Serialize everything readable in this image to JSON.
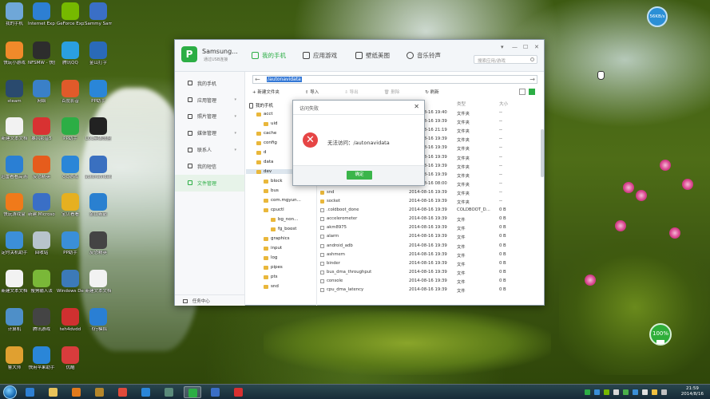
{
  "desktop": {
    "icons": [
      {
        "label": "我的手机",
        "color": "#6fa7d8"
      },
      {
        "label": "快玩小游戏",
        "color": "#f08a2a"
      },
      {
        "label": "steam",
        "color": "#2a4a6e"
      },
      {
        "label": "新建文本文档",
        "color": "#f2f2f2"
      },
      {
        "label": "迅雷看看高清影视",
        "color": "#2a7fd4"
      },
      {
        "label": "快玩游戏盒",
        "color": "#f07a1a"
      },
      {
        "label": "定时关机助手",
        "color": "#3c8fd8"
      },
      {
        "label": "新建文本文档",
        "color": "#f2f2f2"
      },
      {
        "label": "计算机",
        "color": "#4e8fc8"
      },
      {
        "label": "鲁大师",
        "color": "#e0a030"
      },
      {
        "label": "Internet Explorer",
        "color": "#2d7fd3"
      },
      {
        "label": "NFSMW - 快捷方式",
        "color": "#2d2d2d"
      },
      {
        "label": "网络",
        "color": "#3a80c8"
      },
      {
        "label": "暴风影音5",
        "color": "#d83232"
      },
      {
        "label": "反恐精英",
        "color": "#e65c1c"
      },
      {
        "label": "新建 Microsoft Word",
        "color": "#3a6fc6"
      },
      {
        "label": "回收站",
        "color": "#b8c4cc"
      },
      {
        "label": "搜狗输入法",
        "color": "#7ab838"
      },
      {
        "label": "腾讯游戏",
        "color": "#444444"
      },
      {
        "label": "快用苹果助手",
        "color": "#2a86d8"
      },
      {
        "label": "GeForce Experience",
        "color": "#76b900"
      },
      {
        "label": "腾讯QQ",
        "color": "#2a9fe0"
      },
      {
        "label": "百度影音",
        "color": "#e05a2a"
      },
      {
        "label": "PP助手",
        "color": "#2cae45"
      },
      {
        "label": "QQ游戏",
        "color": "#2a86d8"
      },
      {
        "label": "宝贝看看",
        "color": "#e6b020"
      },
      {
        "label": "PP助手",
        "color": "#3a8fd8"
      },
      {
        "label": "Windows Defender",
        "color": "#3c7ab8"
      },
      {
        "label": "teh4dvdd",
        "color": "#d03030"
      },
      {
        "label": "优酷",
        "color": "#d83c3c"
      },
      {
        "label": "Sammy Sam",
        "color": "#3a6fc6"
      },
      {
        "label": "金山打字",
        "color": "#2a6ab8"
      },
      {
        "label": "PP助手",
        "color": "#2a86d8"
      },
      {
        "label": "LOL英雄联盟",
        "color": "#222222"
      },
      {
        "label": "autonavidata",
        "color": "#3a70c0"
      },
      {
        "label": "金山毒霸",
        "color": "#2a80d0"
      },
      {
        "label": "反恐精英",
        "color": "#444444"
      },
      {
        "label": "新建文本文档",
        "color": "#f2f2f2"
      },
      {
        "label": "飞行模拟",
        "color": "#2a7fd4"
      }
    ]
  },
  "app": {
    "device_name": "Samsung...",
    "device_sub": "通过USB连接",
    "tabs": [
      {
        "label": "我的手机",
        "active": true
      },
      {
        "label": "应用游戏",
        "active": false
      },
      {
        "label": "壁纸美图",
        "active": false
      },
      {
        "label": "音乐铃声",
        "active": false
      }
    ],
    "search_placeholder": "搜索应用/游戏",
    "window_controls": [
      "▾",
      "—",
      "☐",
      "✕"
    ],
    "sidebar": [
      {
        "label": "我的手机",
        "active": false
      },
      {
        "label": "应用管理",
        "active": false
      },
      {
        "label": "照片管理",
        "active": false
      },
      {
        "label": "媒体管理",
        "active": false
      },
      {
        "label": "联系人",
        "active": false
      },
      {
        "label": "我的短信",
        "active": false
      },
      {
        "label": "文件管理",
        "active": true
      }
    ],
    "sidebar_footer": "任务中心",
    "path": "/autonavidata",
    "toolbar": [
      "新建文件夹",
      "导入",
      "导出",
      "删除",
      "刷新"
    ],
    "tree": [
      {
        "label": "我的手机",
        "level": 0,
        "type": "phone"
      },
      {
        "label": "acct",
        "level": 1,
        "type": "folder"
      },
      {
        "label": "uid",
        "level": 2,
        "type": "folder"
      },
      {
        "label": "cache",
        "level": 1,
        "type": "folder"
      },
      {
        "label": "config",
        "level": 1,
        "type": "folder"
      },
      {
        "label": "d",
        "level": 1,
        "type": "folder"
      },
      {
        "label": "data",
        "level": 1,
        "type": "folder"
      },
      {
        "label": "dev",
        "level": 1,
        "type": "folder"
      },
      {
        "label": "block",
        "level": 2,
        "type": "folder"
      },
      {
        "label": "bus",
        "level": 2,
        "type": "folder"
      },
      {
        "label": "com.mgyun...",
        "level": 2,
        "type": "folder"
      },
      {
        "label": "cpuctl",
        "level": 2,
        "type": "folder"
      },
      {
        "label": "bg_non...",
        "level": 3,
        "type": "folder"
      },
      {
        "label": "fg_boost",
        "level": 3,
        "type": "folder"
      },
      {
        "label": "graphics",
        "level": 2,
        "type": "folder"
      },
      {
        "label": "input",
        "level": 2,
        "type": "folder"
      },
      {
        "label": "log",
        "level": 2,
        "type": "folder"
      },
      {
        "label": "pipes",
        "level": 2,
        "type": "folder"
      },
      {
        "label": "pts",
        "level": 2,
        "type": "folder"
      },
      {
        "label": "snd",
        "level": 2,
        "type": "folder"
      }
    ],
    "list_headers": [
      "类型",
      "大小"
    ],
    "rows": [
      {
        "name": "",
        "date": "2014-08-16 19:40",
        "type": "文件夹",
        "size": "--",
        "kind": "folder"
      },
      {
        "name": "",
        "date": "2014-08-16 19:39",
        "type": "文件夹",
        "size": "--",
        "kind": "folder"
      },
      {
        "name": "",
        "date": "2014-08-16 21:19",
        "type": "文件夹",
        "size": "--",
        "kind": "folder"
      },
      {
        "name": "",
        "date": "2014-08-16 19:39",
        "type": "文件夹",
        "size": "--",
        "kind": "folder"
      },
      {
        "name": "",
        "date": "2014-08-16 19:39",
        "type": "文件夹",
        "size": "--",
        "kind": "folder"
      },
      {
        "name": "",
        "date": "2014-08-16 19:39",
        "type": "文件夹",
        "size": "--",
        "kind": "folder"
      },
      {
        "name": "",
        "date": "2014-08-16 19:39",
        "type": "文件夹",
        "size": "--",
        "kind": "folder"
      },
      {
        "name": "",
        "date": "2014-08-16 19:39",
        "type": "文件夹",
        "size": "--",
        "kind": "folder"
      },
      {
        "name": "",
        "date": "2014-08-16 08:00",
        "type": "文件夹",
        "size": "--",
        "kind": "folder"
      },
      {
        "name": "snd",
        "date": "2014-08-16 19:39",
        "type": "文件夹",
        "size": "--",
        "kind": "folder"
      },
      {
        "name": "socket",
        "date": "2014-08-16 19:39",
        "type": "文件夹",
        "size": "--",
        "kind": "folder"
      },
      {
        "name": ".coldboot_done",
        "date": "2014-08-16 19:39",
        "type": "COLDBOOT_D...",
        "size": "0 B",
        "kind": "file"
      },
      {
        "name": "accelerometer",
        "date": "2014-08-16 19:39",
        "type": "文件",
        "size": "0 B",
        "kind": "file"
      },
      {
        "name": "akm8975",
        "date": "2014-08-16 19:39",
        "type": "文件",
        "size": "0 B",
        "kind": "file"
      },
      {
        "name": "alarm",
        "date": "2014-08-16 19:39",
        "type": "文件",
        "size": "0 B",
        "kind": "file"
      },
      {
        "name": "android_adb",
        "date": "2014-08-16 19:39",
        "type": "文件",
        "size": "0 B",
        "kind": "file"
      },
      {
        "name": "ashmem",
        "date": "2014-08-16 19:39",
        "type": "文件",
        "size": "0 B",
        "kind": "file"
      },
      {
        "name": "binder",
        "date": "2014-08-16 19:39",
        "type": "文件",
        "size": "0 B",
        "kind": "file"
      },
      {
        "name": "bus_dma_throughput",
        "date": "2014-08-16 19:39",
        "type": "文件",
        "size": "0 B",
        "kind": "file"
      },
      {
        "name": "console",
        "date": "2014-08-16 19:39",
        "type": "文件",
        "size": "0 B",
        "kind": "file"
      },
      {
        "name": "cpu_dma_latency",
        "date": "2014-08-16 19:39",
        "type": "文件",
        "size": "0 B",
        "kind": "file"
      }
    ],
    "dialog": {
      "title": "访问失败",
      "message": "无法访问：/autonavidata",
      "ok_label": "确定",
      "close_glyph": "✕",
      "error_glyph": "✕"
    }
  },
  "overlays": {
    "speed_text": "56KB/s",
    "battery_text": "100%"
  },
  "taskbar": {
    "items": [
      {
        "name": "ie-taskbar",
        "color": "#2d7fd3",
        "active": false
      },
      {
        "name": "explorer-taskbar",
        "color": "#e6c25a",
        "active": false
      },
      {
        "name": "media-player-taskbar",
        "color": "#e07a1c",
        "active": false
      },
      {
        "name": "game-taskbar",
        "color": "#b4862a",
        "active": false
      },
      {
        "name": "chrome-taskbar",
        "color": "#e04a3a",
        "active": false
      },
      {
        "name": "kuaiyong-taskbar",
        "color": "#2a86d8",
        "active": false
      },
      {
        "name": "folder-taskbar",
        "color": "#5a8a7a",
        "active": false
      },
      {
        "name": "pp-assistant-taskbar",
        "color": "#2cae45",
        "active": true
      },
      {
        "name": "samsung-taskbar",
        "color": "#3a6fc6",
        "active": false
      },
      {
        "name": "lips-taskbar",
        "color": "#d83030",
        "active": false
      }
    ],
    "time": "21:59",
    "date": "2014/8/16"
  }
}
